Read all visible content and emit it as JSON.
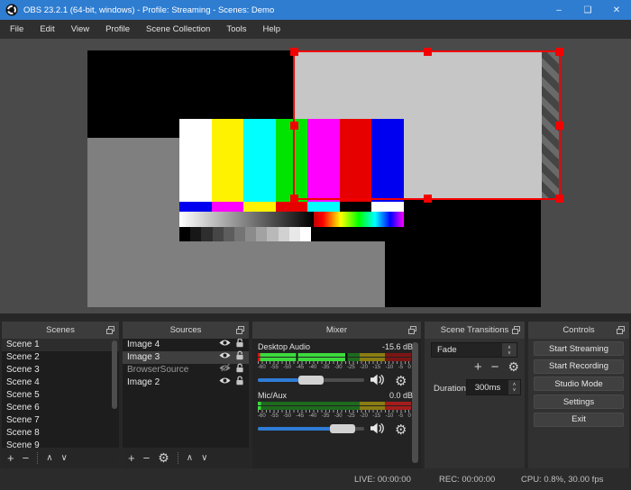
{
  "window": {
    "title": "OBS 23.2.1 (64-bit, windows) - Profile: Streaming - Scenes: Demo",
    "buttons": {
      "minimize": "–",
      "maximize": "❑",
      "close": "✕"
    }
  },
  "menu": {
    "items": [
      "File",
      "Edit",
      "View",
      "Profile",
      "Scene Collection",
      "Tools",
      "Help"
    ]
  },
  "preview": {
    "background_color": "#4a4a4a",
    "canvas_color": "#000000",
    "selection_color": "#f30000",
    "gray_source_color": "#7f7f7f",
    "selected_source_color": "#c6c6c6",
    "color_bars": {
      "main": [
        "#ffffff",
        "#fff200",
        "#00ffff",
        "#00e400",
        "#ff00ff",
        "#e60000",
        "#0000f0"
      ],
      "secondary": [
        "#0000f0",
        "#ff00ff",
        "#fff200",
        "#e60000",
        "#00ffff",
        "#000000",
        "#ffffff"
      ]
    }
  },
  "panels": {
    "scenes": {
      "title": "Scenes",
      "items": [
        "Scene 1",
        "Scene 2",
        "Scene 3",
        "Scene 4",
        "Scene 5",
        "Scene 6",
        "Scene 7",
        "Scene 8",
        "Scene 9"
      ],
      "selected_index": 0
    },
    "sources": {
      "title": "Sources",
      "items": [
        {
          "name": "Image 4",
          "visible": true,
          "locked": false,
          "selected": false
        },
        {
          "name": "Image 3",
          "visible": true,
          "locked": false,
          "selected": true
        },
        {
          "name": "BrowserSource",
          "visible": false,
          "locked": false,
          "selected": false
        },
        {
          "name": "Image 2",
          "visible": true,
          "locked": false,
          "selected": false
        }
      ]
    },
    "mixer": {
      "title": "Mixer",
      "scale_labels": [
        "-60",
        "-55",
        "-50",
        "-45",
        "-40",
        "-35",
        "-30",
        "-25",
        "-20",
        "-15",
        "-10",
        "-5",
        "0"
      ],
      "channels": [
        {
          "name": "Desktop Audio",
          "level_db": "-15.6 dB",
          "volume_slider_pct": 50
        },
        {
          "name": "Mic/Aux",
          "level_db": "0.0 dB",
          "volume_slider_pct": 80
        }
      ]
    },
    "transitions": {
      "title": "Scene Transitions",
      "selected_transition": "Fade",
      "duration_label": "Duration",
      "duration_value": "300ms"
    },
    "controls": {
      "title": "Controls",
      "buttons": [
        "Start Streaming",
        "Start Recording",
        "Studio Mode",
        "Settings",
        "Exit"
      ]
    }
  },
  "statusbar": {
    "live": "LIVE: 00:00:00",
    "rec": "REC: 00:00:00",
    "cpu": "CPU: 0.8%, 30.00 fps"
  }
}
